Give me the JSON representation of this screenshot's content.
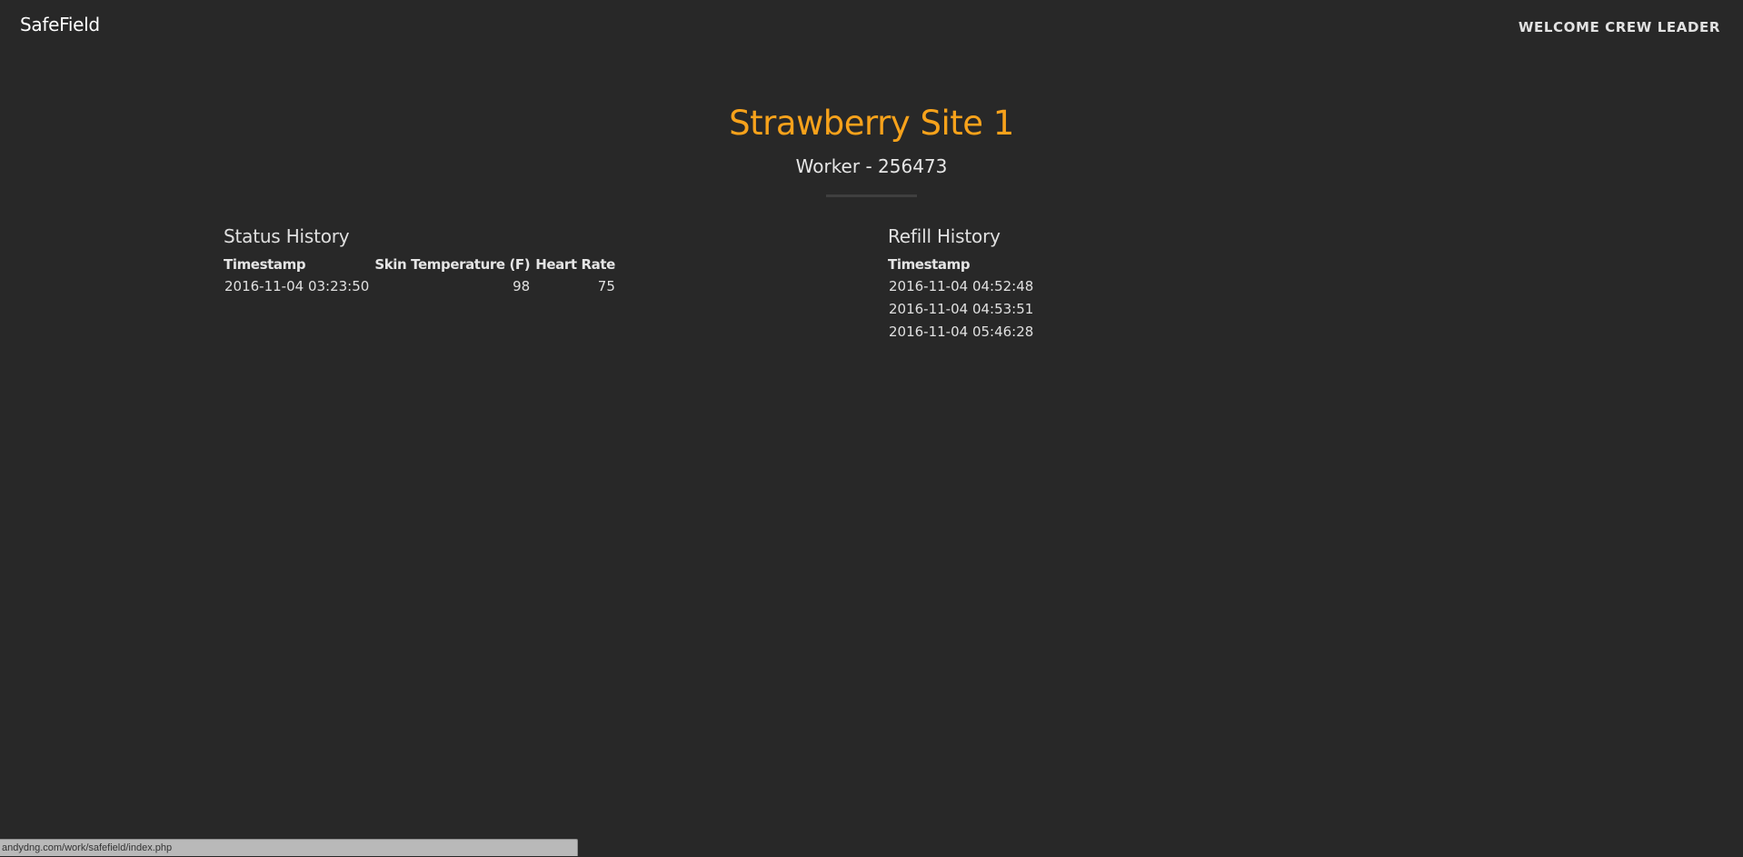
{
  "header": {
    "brand": "SafeField",
    "welcome": "WELCOME CREW LEADER"
  },
  "page": {
    "site_title": "Strawberry Site 1",
    "worker_title": "Worker - 256473"
  },
  "status_history": {
    "title": "Status History",
    "columns": [
      "Timestamp",
      "Skin Temperature (F)",
      "Heart Rate"
    ],
    "rows": [
      {
        "timestamp": "2016-11-04 03:23:50",
        "skin_temperature": "98",
        "heart_rate": "75"
      }
    ]
  },
  "refill_history": {
    "title": "Refill History",
    "columns": [
      "Timestamp"
    ],
    "rows": [
      {
        "timestamp": "2016-11-04 04:52:48"
      },
      {
        "timestamp": "2016-11-04 04:53:51"
      },
      {
        "timestamp": "2016-11-04 05:46:28"
      }
    ]
  },
  "browser_status": {
    "url": "andydng.com/work/safefield/index.php"
  }
}
